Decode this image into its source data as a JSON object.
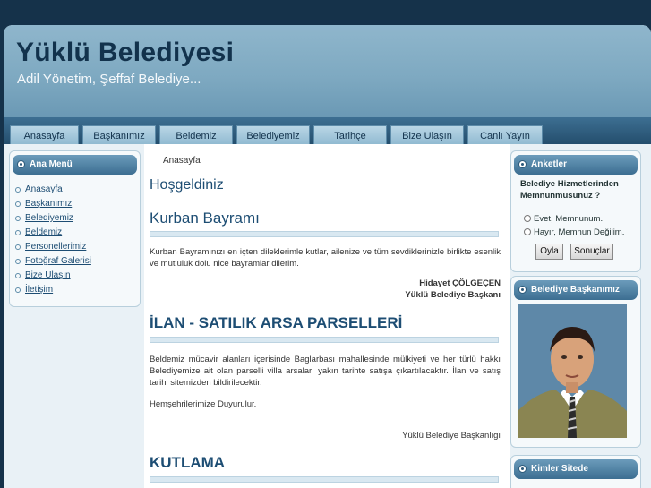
{
  "header": {
    "title": "Yüklü Belediyesi",
    "subtitle": "Adil Yönetim, Şeffaf Belediye..."
  },
  "nav": {
    "tabs": [
      "Anasayfa",
      "Başkanımız",
      "Beldemiz",
      "Belediyemiz",
      "Tarihçe",
      "Bize Ulaşın",
      "Canlı Yayın"
    ]
  },
  "sidebar": {
    "menu_title": "Ana Menü",
    "items": [
      "Anasayfa",
      "Başkanımız",
      "Belediyemiz",
      "Beldemiz",
      "Personellerimiz",
      "Fotoğraf Galerisi",
      "Bize Ulaşın",
      "İletişim"
    ]
  },
  "main": {
    "breadcrumb": "Anasayfa",
    "welcome": "Hoşgeldiniz",
    "sections": [
      {
        "title": "Kurban Bayramı",
        "body": "Kurban Bayramınızı en içten dileklerimle kutlar, ailenize ve tüm sevdiklerinizle birlikte esenlik ve mutluluk dolu nice bayramlar dilerim.",
        "signature_name": "Hidayet ÇÖLGEÇEN",
        "signature_title": "Yüklü Belediye Başkanı"
      },
      {
        "title": "İLAN - SATILIK ARSA PARSELLERİ",
        "body": "Beldemiz mücavir alanları içerisinde Baglarbası mahallesinde mülkiyeti ve her türlü hakkı Belediyemize ait olan parselli villa arsaları yakın tarihte satışa çıkartılacaktır. İlan ve satış tarihi sitemizden bildirilecektir.",
        "note": "Hemşehrilerimize Duyurulur.",
        "signature": "Yüklü Belediye Başkanlıgı"
      },
      {
        "title": "KUTLAMA"
      }
    ]
  },
  "right": {
    "poll_title": "Anketler",
    "poll_question": "Belediye Hizmetlerinden Memnunmusunuz ?",
    "poll_options": [
      "Evet, Memnunum.",
      "Hayır, Memnun Değilim."
    ],
    "vote_button": "Oyla",
    "results_button": "Sonuçlar",
    "mayor_title": "Belediye Başkanımız",
    "online_title": "Kimler Sitede"
  }
}
